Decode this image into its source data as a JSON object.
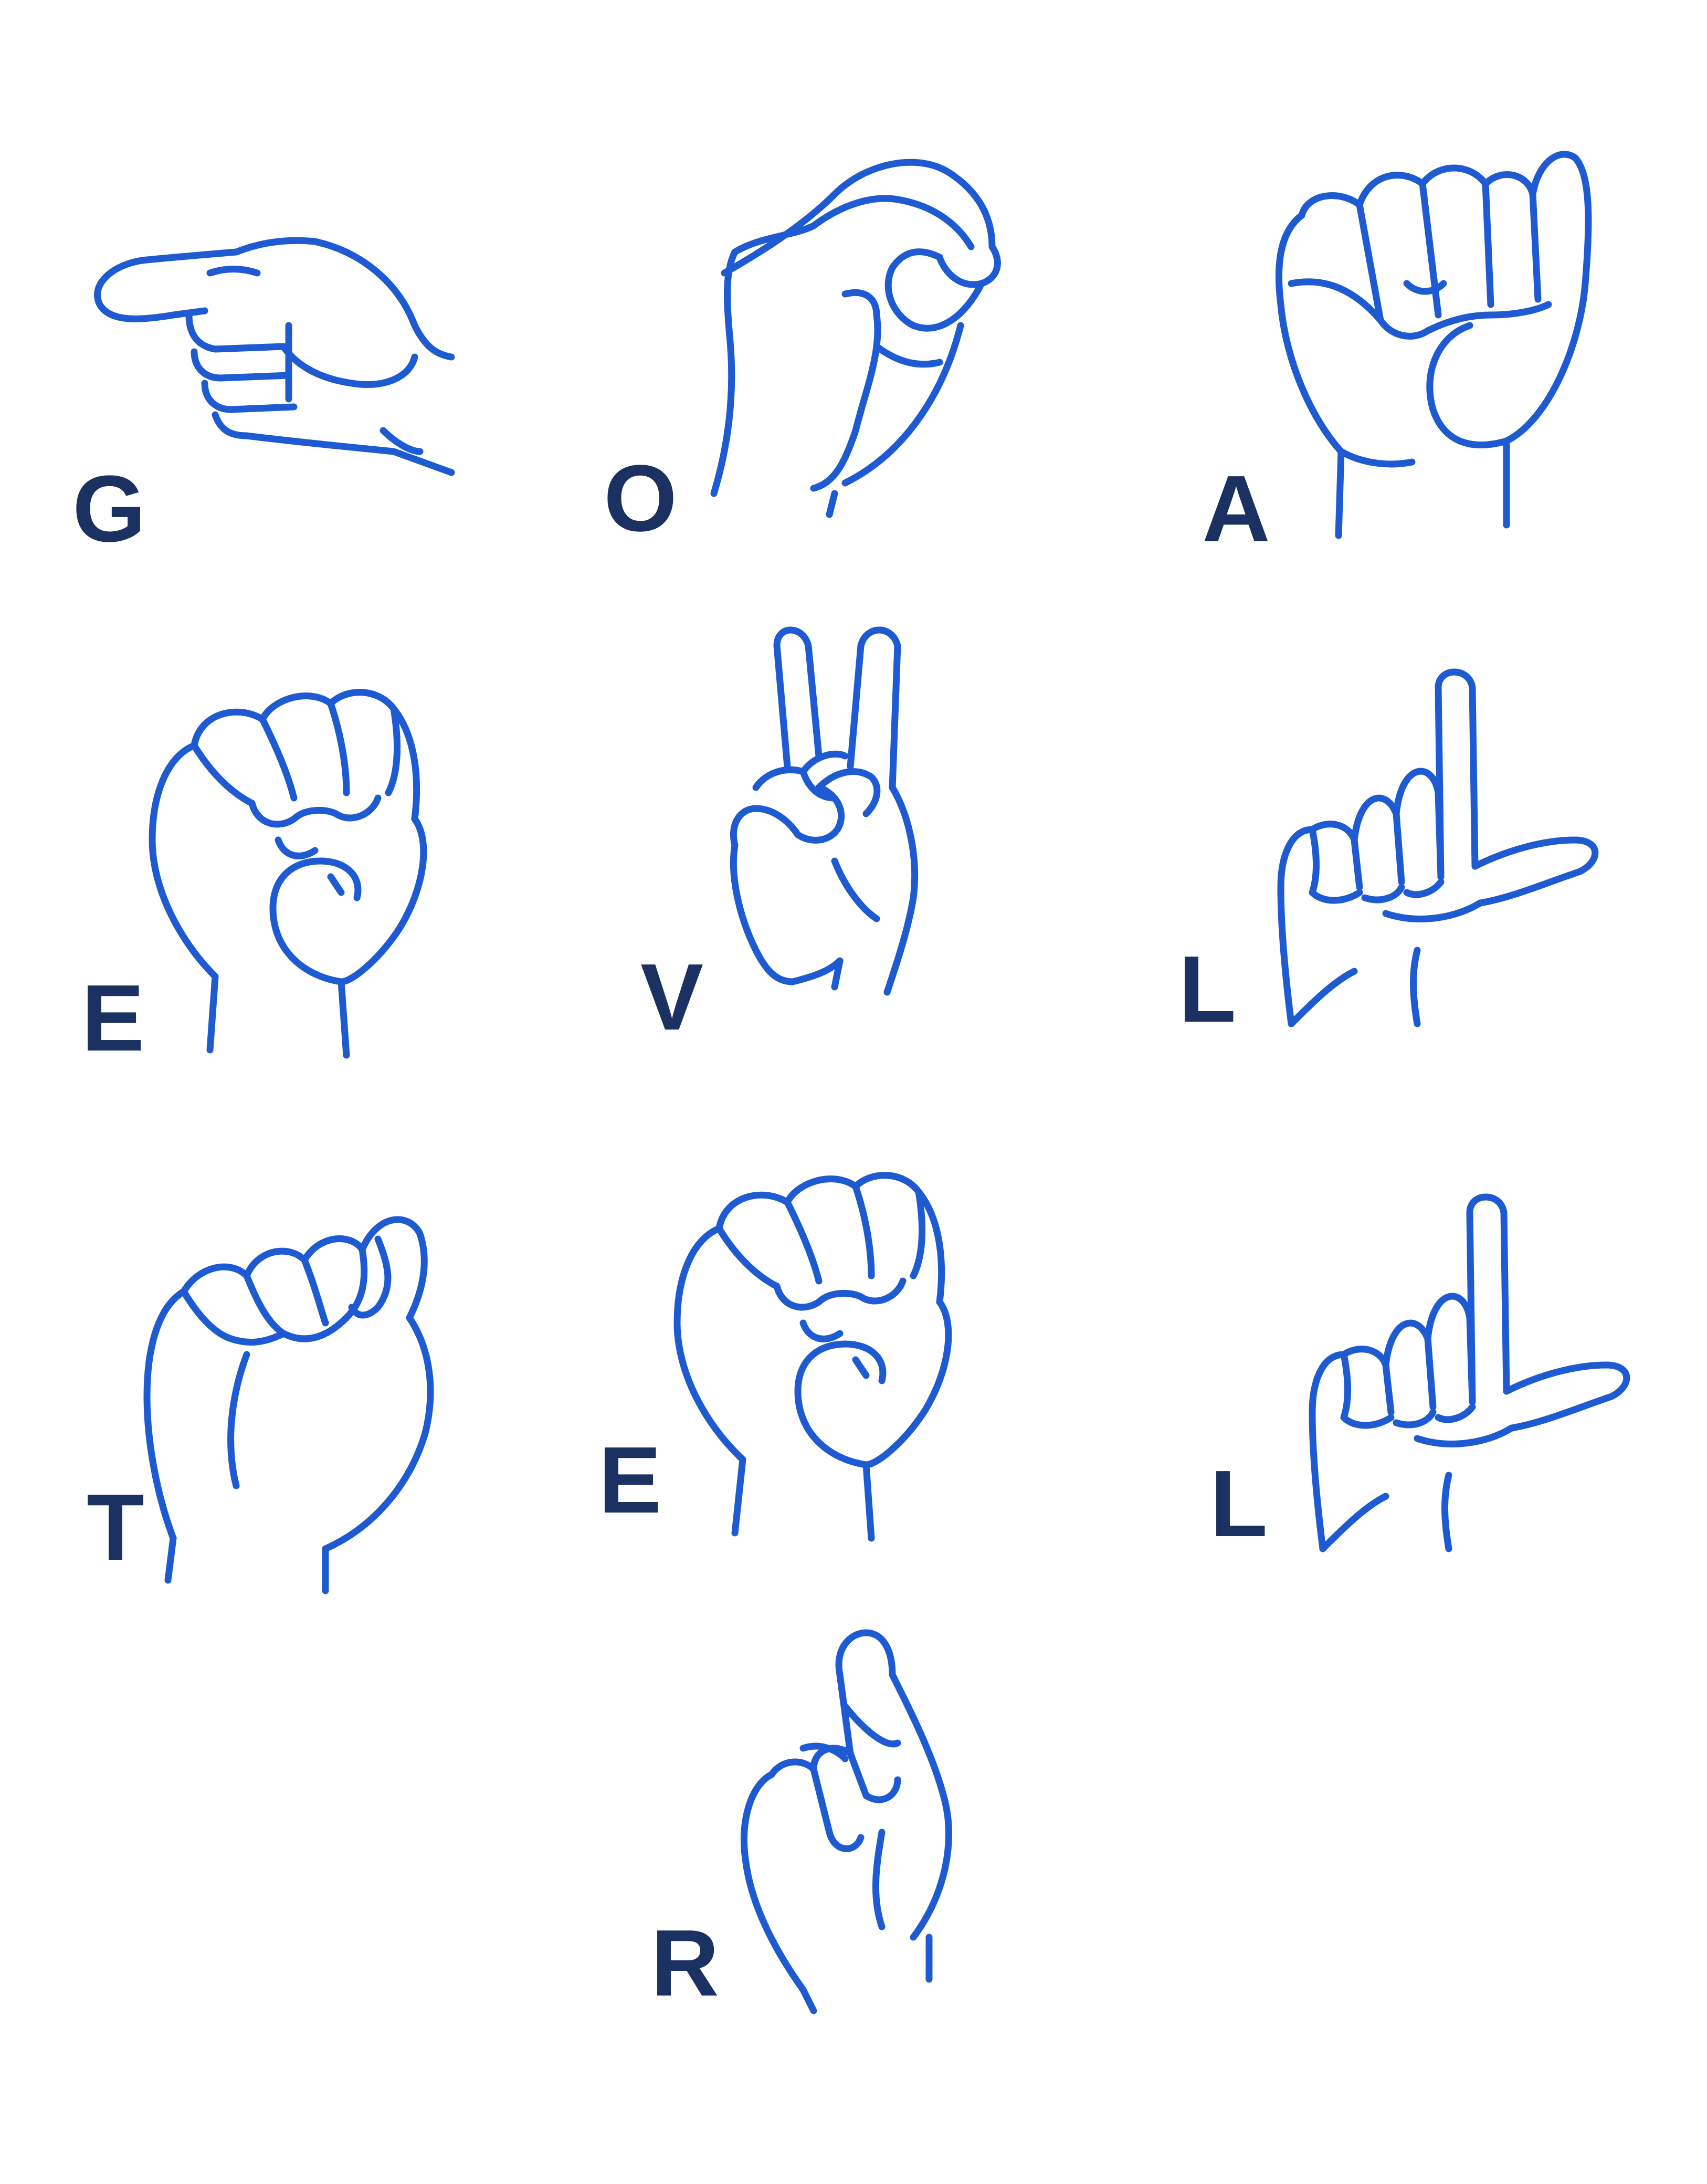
{
  "colors": {
    "hand_stroke": "#1e5bd2",
    "letter_fill": "#1b3162",
    "background": "#ffffff"
  },
  "signs": [
    {
      "letter": "G",
      "handshape": "g-handshape-icon"
    },
    {
      "letter": "O",
      "handshape": "o-handshape-icon"
    },
    {
      "letter": "A",
      "handshape": "a-handshape-icon"
    },
    {
      "letter": "E",
      "handshape": "e-handshape-icon"
    },
    {
      "letter": "V",
      "handshape": "v-handshape-icon"
    },
    {
      "letter": "L",
      "handshape": "l-handshape-icon"
    },
    {
      "letter": "T",
      "handshape": "t-handshape-icon"
    },
    {
      "letter": "E",
      "handshape": "e-handshape-icon"
    },
    {
      "letter": "L",
      "handshape": "l-handshape-icon"
    },
    {
      "letter": "R",
      "handshape": "r-handshape-icon"
    }
  ]
}
